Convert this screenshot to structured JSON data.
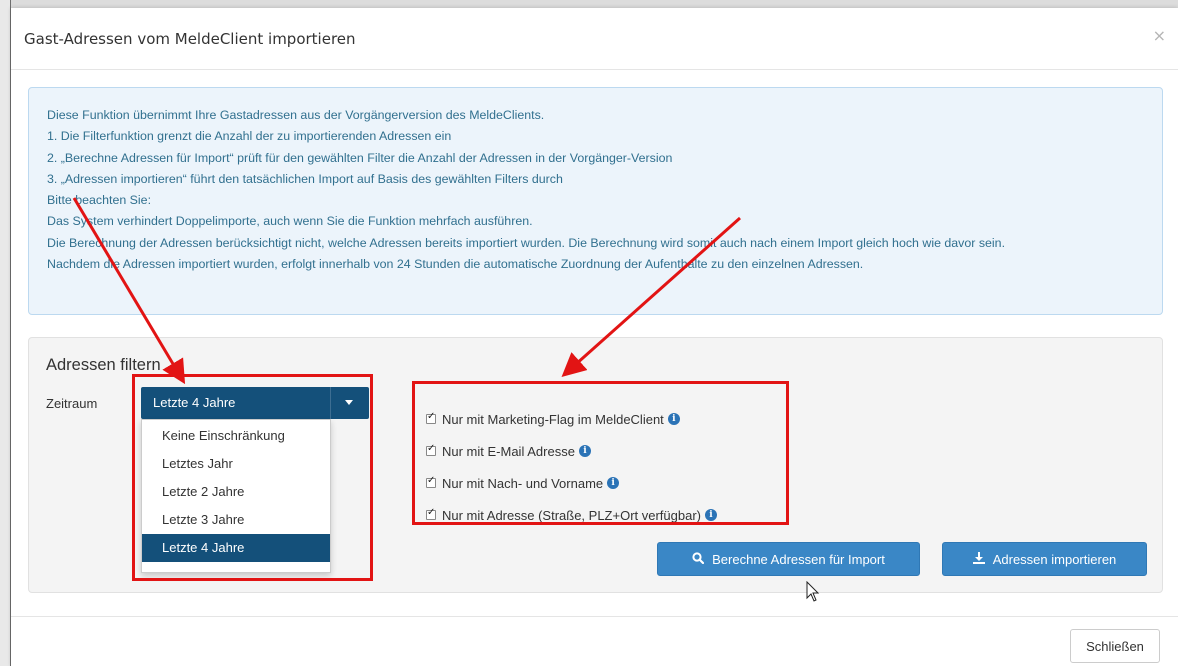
{
  "modal": {
    "title": "Gast-Adressen vom MeldeClient importieren",
    "close_glyph": "×"
  },
  "info": {
    "lines": [
      "Diese Funktion übernimmt Ihre Gastadressen aus der Vorgängerversion des MeldeClients.",
      "1. Die Filterfunktion grenzt die Anzahl der zu importierenden Adressen ein",
      "2. „Berechne Adressen für Import“ prüft für den gewählten Filter die Anzahl der Adressen in der Vorgänger-Version",
      "3. „Adressen importieren“ führt den tatsächlichen Import auf Basis des gewählten Filters durch",
      "Bitte beachten Sie:",
      "Das System verhindert Doppelimporte, auch wenn Sie die Funktion mehrfach ausführen.",
      "Die Berechnung der Adressen berücksichtigt nicht, welche Adressen bereits importiert wurden. Die Berechnung wird somit auch nach einem Import gleich hoch wie davor sein.",
      "Nachdem die Adressen importiert wurden, erfolgt innerhalb von 24 Stunden die automatische Zuordnung der Aufenthalte zu den einzelnen Adressen."
    ]
  },
  "filter": {
    "title": "Adressen filtern",
    "zeitraum_label": "Zeitraum",
    "selected": "Letzte 4 Jahre",
    "options": [
      "Keine Einschränkung",
      "Letztes Jahr",
      "Letzte 2 Jahre",
      "Letzte 3 Jahre",
      "Letzte 4 Jahre"
    ],
    "checkboxes": [
      {
        "label": "Nur mit Marketing-Flag im MeldeClient",
        "checked": true
      },
      {
        "label": "Nur mit E-Mail Adresse",
        "checked": true
      },
      {
        "label": "Nur mit Nach- und Vorname",
        "checked": true
      },
      {
        "label": "Nur mit Adresse (Straße, PLZ+Ort verfügbar)",
        "checked": true
      }
    ],
    "info_glyph": "i"
  },
  "buttons": {
    "calculate": "Berechne Adressen für Import",
    "import": "Adressen importieren",
    "close": "Schließen"
  },
  "colors": {
    "primary": "#3a87c6",
    "select_bg": "#14507a",
    "info_bg": "#ecf4fb",
    "info_text": "#31708f",
    "annotation_red": "#e21414"
  },
  "icons": {
    "calculate": "search-icon",
    "import": "download-icon",
    "info": "info-circle-icon"
  }
}
